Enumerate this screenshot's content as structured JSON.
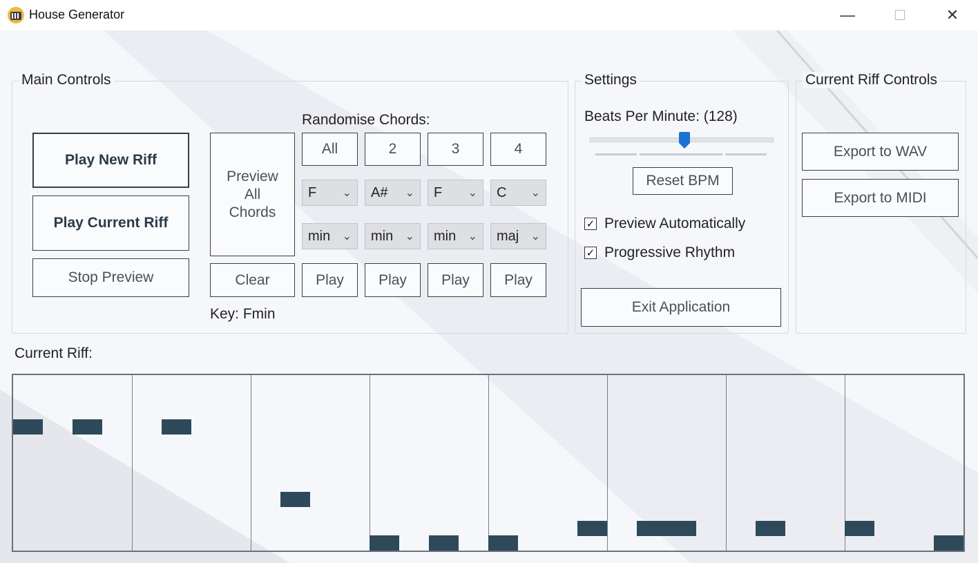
{
  "window": {
    "title": "House Generator",
    "minimize": "—",
    "maximize": "☐",
    "close": "✕"
  },
  "main_controls": {
    "label": "Main Controls",
    "play_new_riff": "Play New Riff",
    "play_current_riff": "Play Current Riff",
    "stop_preview": "Stop Preview",
    "preview_all_chords": [
      "Preview",
      "All",
      "Chords"
    ],
    "clear": "Clear",
    "key": "Key: Fmin",
    "randomise_label": "Randomise Chords:",
    "randomise_buttons": [
      "All",
      "2",
      "3",
      "4"
    ],
    "chord_roots": [
      "F",
      "A#",
      "F",
      "C"
    ],
    "chord_qualities": [
      "min",
      "min",
      "min",
      "maj"
    ],
    "play_buttons": [
      "Play",
      "Play",
      "Play",
      "Play"
    ]
  },
  "settings": {
    "label": "Settings",
    "bpm_label": "Beats Per Minute: (128)",
    "bpm_value": 128,
    "bpm_slider_fraction": 0.52,
    "reset_bpm": "Reset BPM",
    "preview_automatically": "Preview Automatically",
    "preview_automatically_checked": true,
    "progressive_rhythm": "Progressive Rhythm",
    "progressive_rhythm_checked": true,
    "exit_application": "Exit Application"
  },
  "riff_controls": {
    "label": "Current Riff Controls",
    "export_wav": "Export to WAV",
    "export_midi": "Export to MIDI"
  },
  "current_riff": {
    "label": "Current Riff:",
    "bars": 8,
    "steps_per_bar": 8,
    "pitch_rows": 10,
    "notes": [
      {
        "start": 0,
        "length": 1,
        "row": 0
      },
      {
        "start": 2,
        "length": 1,
        "row": 0
      },
      {
        "start": 5,
        "length": 1,
        "row": 0
      },
      {
        "start": 9,
        "length": 1,
        "row": 5
      },
      {
        "start": 12,
        "length": 1,
        "row": 8
      },
      {
        "start": 14,
        "length": 1,
        "row": 8
      },
      {
        "start": 16,
        "length": 1,
        "row": 8
      },
      {
        "start": 19,
        "length": 1,
        "row": 7
      },
      {
        "start": 21,
        "length": 2,
        "row": 7
      },
      {
        "start": 25,
        "length": 1,
        "row": 7
      },
      {
        "start": 28,
        "length": 1,
        "row": 7
      },
      {
        "start": 31,
        "length": 1,
        "row": 8
      }
    ],
    "note_color": "#2e4a5a"
  }
}
